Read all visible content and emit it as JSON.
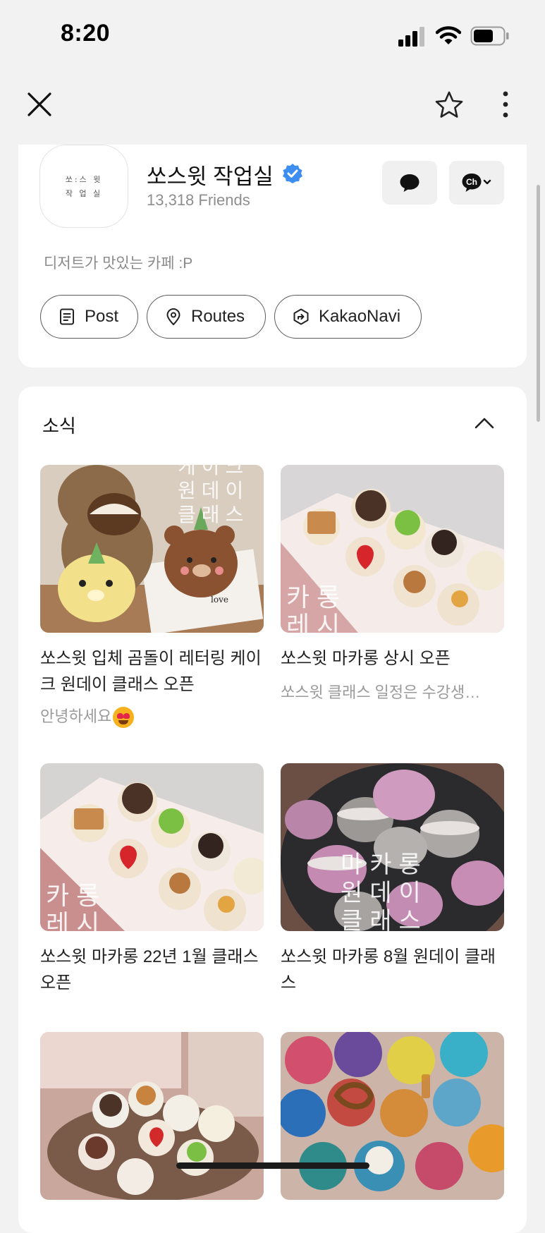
{
  "status_bar": {
    "time": "8:20"
  },
  "nav": {
    "close_icon": "close-icon",
    "bookmark_icon": "star-icon",
    "more_icon": "more-vertical-icon"
  },
  "profile": {
    "logo_text_line1": "쏘:스 윗",
    "logo_text_line2": "작 업 실",
    "name": "쏘스윗 작업실",
    "friends": "13,318 Friends",
    "description": "디저트가 맛있는 카페 :P",
    "verified": true,
    "chat_icon": "chat-bubble-icon",
    "channel_icon": "channel-add-icon",
    "channel_glyph": "Ch",
    "buttons": [
      {
        "label": "Post",
        "icon": "document-icon"
      },
      {
        "label": "Routes",
        "icon": "location-pin-icon"
      },
      {
        "label": "KakaoNavi",
        "icon": "navigation-icon"
      }
    ]
  },
  "news": {
    "section_title": "소식",
    "posts": [
      {
        "title": "쏘스윗 입체 곰돌이 레터링 케이크 원데이 클래스 오픈",
        "subtitle": "안녕하세요",
        "image_overlay": [
          "케이크",
          "원데이",
          "클래스"
        ]
      },
      {
        "title": "쏘스윗 마카롱 상시 오픈",
        "subtitle": "쏘스윗 클래스 일정은 수강생…",
        "image_overlay": [
          "카롱",
          "레시"
        ]
      },
      {
        "title": "쏘스윗 마카롱 22년 1월 클래스 오픈",
        "subtitle": "",
        "image_overlay": [
          "카롱",
          "레시"
        ]
      },
      {
        "title": "쏘스윗 마카롱 8월 원데이 클래스",
        "subtitle": "",
        "image_overlay": [
          "마카롱",
          "원데이",
          "클래스"
        ]
      },
      {
        "title": "",
        "subtitle": "",
        "image_overlay": []
      },
      {
        "title": "",
        "subtitle": "",
        "image_overlay": []
      }
    ]
  },
  "colors": {
    "verified_blue": "#3d8ef0",
    "background": "#f2f2f2",
    "card": "#ffffff",
    "muted_text": "#8e8e8e"
  }
}
